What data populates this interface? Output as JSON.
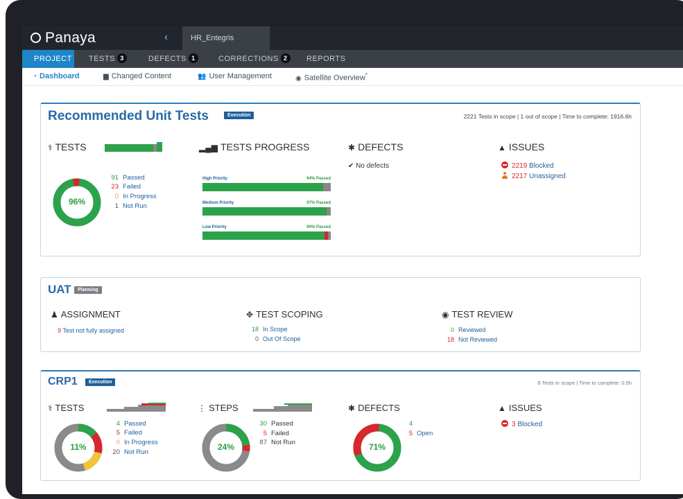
{
  "app": {
    "logo": "Panaya",
    "project_tab": "HR_Entegris"
  },
  "nav": [
    {
      "label": "PROJECT",
      "badge": ""
    },
    {
      "label": "TESTS",
      "badge": "3"
    },
    {
      "label": "DEFECTS",
      "badge": "1"
    },
    {
      "label": "CORRECTIONS",
      "badge": "2"
    },
    {
      "label": "REPORTS",
      "badge": ""
    }
  ],
  "subnav": [
    {
      "label": "Dashboard",
      "icon": "dashboard-icon"
    },
    {
      "label": "Changed Content",
      "icon": "document-icon"
    },
    {
      "label": "User Management",
      "icon": "users-icon"
    },
    {
      "label": "Satellite Overview",
      "icon": "satellite-icon",
      "superscript": "*"
    }
  ],
  "cards": {
    "rut": {
      "title": "Recommended Unit Tests",
      "status": "Execution",
      "scope_note": "2221 Tests in scope | 1 out of scope | Time to complete: 1916.6h",
      "tests": {
        "heading": "TESTS",
        "donut_pct": "96%",
        "legend": [
          {
            "num": "91",
            "label": "Passed",
            "color": "#2a9d3e"
          },
          {
            "num": "23",
            "label": "Failed",
            "color": "#d7262e"
          },
          {
            "num": "0",
            "label": "In Progress",
            "color": "#e9a23b"
          },
          {
            "num": "1",
            "label": "Not Run",
            "color": "#555555"
          }
        ]
      },
      "progress": {
        "heading": "TESTS PROGRESS",
        "bars": [
          {
            "label": "High Priority",
            "pct_text": "94% Passed",
            "passed": 0.94,
            "failed": 0.0
          },
          {
            "label": "Medium Priority",
            "pct_text": "97% Passed",
            "passed": 0.97,
            "failed": 0.0
          },
          {
            "label": "Low Priority",
            "pct_text": "90% Passed",
            "passed": 0.95,
            "failed": 0.03
          }
        ]
      },
      "defects": {
        "heading": "DEFECTS",
        "text": "No defects"
      },
      "issues": {
        "heading": "ISSUES",
        "rows": [
          {
            "num": "2219",
            "label": "Blocked",
            "icon": "blocked-icon"
          },
          {
            "num": "2217",
            "label": "Unassigned",
            "icon": "unassigned-icon"
          }
        ]
      }
    },
    "uat": {
      "title": "UAT",
      "status": "Planning",
      "assignment": {
        "heading": "ASSIGNMENT",
        "num": "9",
        "text": "Test not fully assigned"
      },
      "scoping": {
        "heading": "TEST SCOPING",
        "rows": [
          {
            "num": "18",
            "label": "In Scope"
          },
          {
            "num": "0",
            "label": "Out Of Scope"
          }
        ]
      },
      "review": {
        "heading": "TEST REVIEW",
        "rows": [
          {
            "num": "0",
            "label": "Reviewed"
          },
          {
            "num": "18",
            "label": "Not Reviewed"
          }
        ]
      }
    },
    "crp1": {
      "title": "CRP1",
      "status": "Execution",
      "scope_note": "8 Tests in scope | Time to complete: 0.5h",
      "tests": {
        "heading": "TESTS",
        "donut_pct": "11%",
        "legend": [
          {
            "num": "4",
            "label": "Passed",
            "color": "#2a9d3e"
          },
          {
            "num": "5",
            "label": "Failed",
            "color": "#d7262e"
          },
          {
            "num": "0",
            "label": "In Progress",
            "color": "#e9a23b"
          },
          {
            "num": "20",
            "label": "Not Run",
            "color": "#555555"
          }
        ]
      },
      "steps": {
        "heading": "STEPS",
        "donut_pct": "24%",
        "legend": [
          {
            "num": "30",
            "label": "Passed",
            "color": "#2a9d3e"
          },
          {
            "num": "5",
            "label": "Failed",
            "color": "#d7262e"
          },
          {
            "num": "87",
            "label": "Not Run",
            "color": "#555555"
          }
        ]
      },
      "defects": {
        "heading": "DEFECTS",
        "donut_pct": "71%",
        "legend": [
          {
            "num": "4",
            "label": "",
            "color": "#2a9d3e"
          },
          {
            "num": "5",
            "label": "Open",
            "color": "#d7262e"
          }
        ]
      },
      "issues": {
        "heading": "ISSUES",
        "rows": [
          {
            "num": "3",
            "label": "Blocked",
            "icon": "blocked-icon"
          }
        ]
      }
    }
  },
  "colors": {
    "accent": "#1e86c8",
    "passed": "#2ca24a",
    "failed": "#d7262e",
    "in_progress": "#f0c43c",
    "not_run": "#8a8a8a"
  }
}
